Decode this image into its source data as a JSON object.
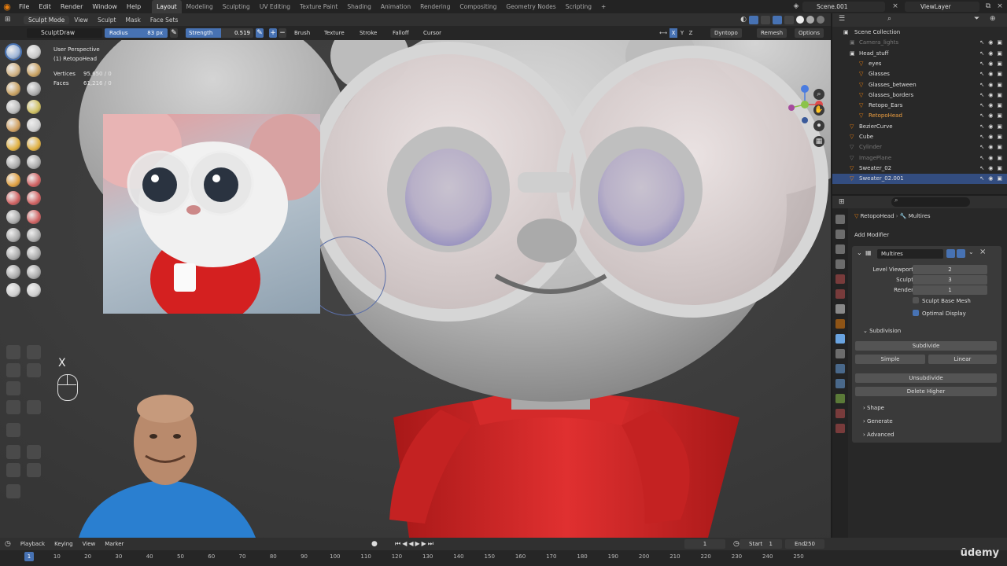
{
  "topbar": {
    "menu": [
      "File",
      "Edit",
      "Render",
      "Window",
      "Help"
    ],
    "workspaces": [
      "Layout",
      "Modeling",
      "Sculpting",
      "UV Editing",
      "Texture Paint",
      "Shading",
      "Animation",
      "Rendering",
      "Compositing",
      "Geometry Nodes",
      "Scripting",
      "+"
    ],
    "active_workspace": "Layout",
    "scene": "Scene.001",
    "view_layer": "ViewLayer"
  },
  "viewport_header": {
    "mode": "Sculpt Mode",
    "menus": [
      "View",
      "Sculpt",
      "Mask",
      "Face Sets"
    ]
  },
  "tool_header": {
    "brush": "SculptDraw",
    "radius_label": "Radius",
    "radius_value": "83 px",
    "strength_label": "Strength",
    "strength_value": "0.519",
    "strength_fraction": 0.519,
    "dropdowns": [
      "Brush",
      "Texture",
      "Stroke",
      "Falloff",
      "Cursor"
    ],
    "axis": [
      "X",
      "Y",
      "Z"
    ],
    "dyntopo": "Dyntopo",
    "remesh": "Remesh",
    "options": "Options"
  },
  "overlay": {
    "perspective": "User Perspective",
    "object": "(1) RetopoHead",
    "stats": [
      {
        "label": "Vertices",
        "value": "95,650 / 0"
      },
      {
        "label": "Faces",
        "value": "61,216 / 0"
      }
    ],
    "key_pressed": "X"
  },
  "outliner": {
    "root": "Scene Collection",
    "rows": [
      {
        "name": "Camera_lights",
        "dim": true
      },
      {
        "name": "Head_stuff",
        "dim": false
      },
      {
        "name": "eyes",
        "dim": false
      },
      {
        "name": "Glasses",
        "dim": false
      },
      {
        "name": "Glasses_between",
        "dim": false
      },
      {
        "name": "Glasses_borders",
        "dim": false
      },
      {
        "name": "Retopo_Ears",
        "dim": false
      },
      {
        "name": "RetopoHead",
        "dim": false,
        "active": true
      },
      {
        "name": "BezierCurve",
        "dim": false
      },
      {
        "name": "Cube",
        "dim": false
      },
      {
        "name": "Cylinder",
        "dim": true
      },
      {
        "name": "ImagePlane",
        "dim": true
      },
      {
        "name": "Sweater_02",
        "dim": false
      },
      {
        "name": "Sweater_02.001",
        "dim": false,
        "selected": true
      }
    ]
  },
  "properties": {
    "object": "RetopoHead",
    "modifier_tab": "Multires",
    "add_modifier": "Add Modifier",
    "modifier_name": "Multires",
    "levels": [
      {
        "label": "Level Viewport",
        "value": "2"
      },
      {
        "label": "Sculpt",
        "value": "3"
      },
      {
        "label": "Render",
        "value": "1"
      }
    ],
    "sculpt_base_mesh": "Sculpt Base Mesh",
    "optimal_display": "Optimal Display",
    "subdivision": "Subdivision",
    "subdivide": "Subdivide",
    "simple": "Simple",
    "linear": "Linear",
    "unsubdivide": "Unsubdivide",
    "delete_higher": "Delete Higher",
    "sections": [
      "Shape",
      "Generate",
      "Advanced"
    ]
  },
  "timeline": {
    "menus": [
      "Playback",
      "Keying",
      "View",
      "Marker"
    ],
    "current_frame": "1",
    "start_label": "Start",
    "start": "1",
    "end_label": "End",
    "end": "250",
    "ticks": [
      "1",
      "10",
      "20",
      "30",
      "40",
      "50",
      "60",
      "70",
      "80",
      "90",
      "100",
      "110",
      "120",
      "130",
      "140",
      "150",
      "160",
      "170",
      "180",
      "190",
      "200",
      "210",
      "220",
      "230",
      "240",
      "250"
    ]
  },
  "watermark": "ūdemy",
  "colors": {
    "accent": "#4772b3",
    "sweater": "#d42a2a",
    "clay": "#bdbdbd"
  }
}
